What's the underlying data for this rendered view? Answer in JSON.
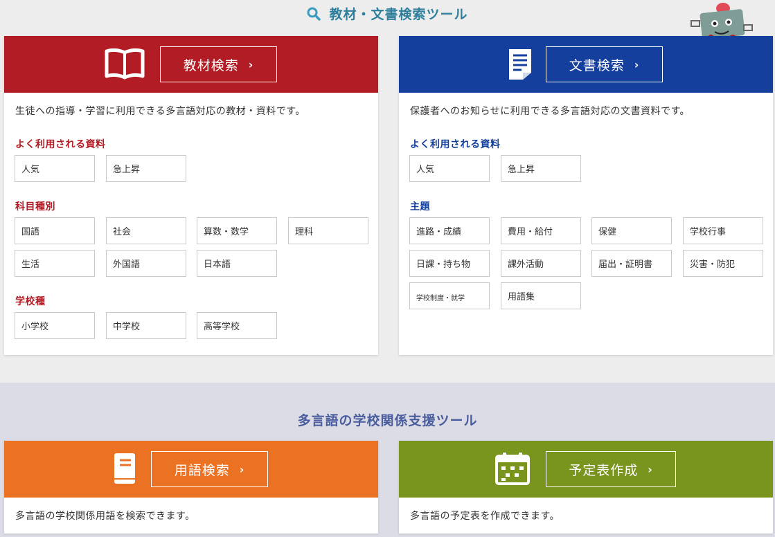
{
  "heading_top": "教材・文書検索ツール",
  "heading_bottom": "多言語の学校関係支援ツール",
  "colors": {
    "red": "#b21c24",
    "blue": "#143f9c",
    "orange": "#ec7223",
    "green": "#79951e",
    "teal": "#2f7f9c"
  },
  "materials": {
    "button": "教材検索",
    "description": "生徒への指導・学習に利用できる多言語対応の教材・資料です。",
    "popular_title": "よく利用される資料",
    "popular": [
      "人気",
      "急上昇"
    ],
    "subjects_title": "科目種別",
    "subjects": [
      "国語",
      "社会",
      "算数・数学",
      "理科",
      "生活",
      "外国語",
      "日本語"
    ],
    "schools_title": "学校種",
    "schools": [
      "小学校",
      "中学校",
      "高等学校"
    ]
  },
  "documents": {
    "button": "文書検索",
    "description": "保護者へのお知らせに利用できる多言語対応の文書資料です。",
    "popular_title": "よく利用される資料",
    "popular": [
      "人気",
      "急上昇"
    ],
    "topics_title": "主題",
    "topics": [
      "進路・成績",
      "費用・給付",
      "保健",
      "学校行事",
      "日課・持ち物",
      "課外活動",
      "届出・証明書",
      "災害・防犯",
      "学校制度・就学",
      "用語集"
    ]
  },
  "glossary": {
    "button": "用語検索",
    "description": "多言語の学校関係用語を検索できます。"
  },
  "schedule": {
    "button": "予定表作成",
    "description": "多言語の予定表を作成できます。"
  },
  "icons": [
    "search-icon",
    "book-icon",
    "document-icon",
    "notebook-icon",
    "calendar-icon",
    "chevron-right-icon",
    "mascot-robot-icon"
  ]
}
